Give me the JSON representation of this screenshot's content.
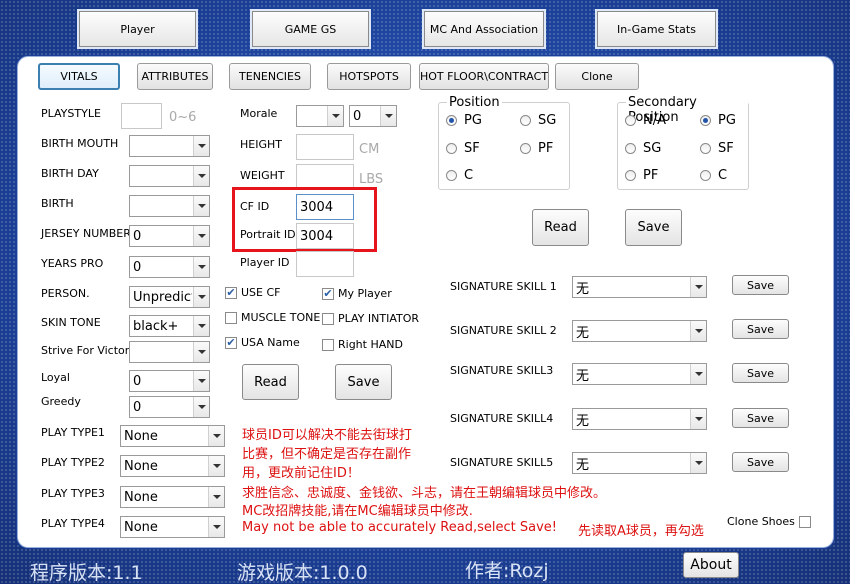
{
  "top_buttons": [
    "Player",
    "GAME GS",
    "MC And Association",
    "In-Game Stats"
  ],
  "tabs": [
    "VITALS",
    "ATTRIBUTES",
    "TENENCIES",
    "HOTSPOTS",
    "HOT FLOOR\\CONTRACT",
    "Clone"
  ],
  "left": {
    "playstyle_label": "PLAYSTYLE",
    "playstyle_hint": "0~6",
    "birth_mouth_label": "BIRTH MOUTH",
    "birth_day_label": "BIRTH DAY",
    "birth_label": "BIRTH",
    "jersey_label": "JERSEY NUMBER",
    "jersey_value": "0",
    "years_pro_label": "YEARS PRO",
    "years_pro_value": "0",
    "person_label": "PERSON.",
    "person_value": "Unpredictable",
    "skin_label": "SKIN TONE",
    "skin_value": "black+",
    "strive_label": "Strive For Victory",
    "loyal_label": "Loyal",
    "loyal_value": "0",
    "greedy_label": "Greedy",
    "greedy_value": "0",
    "play_types": [
      {
        "label": "PLAY TYPE1",
        "value": "None"
      },
      {
        "label": "PLAY TYPE2",
        "value": "None"
      },
      {
        "label": "PLAY TYPE3",
        "value": "None"
      },
      {
        "label": "PLAY TYPE4",
        "value": "None"
      }
    ]
  },
  "middle": {
    "morale_label": "Morale",
    "morale_value": "0",
    "height_label": "HEIGHT",
    "height_unit": "CM",
    "weight_label": "WEIGHT",
    "weight_unit": "LBS",
    "cfid_label": "CF ID",
    "cfid_value": "3004",
    "portrait_label": "Portrait ID",
    "portrait_value": "3004",
    "playerid_label": "Player ID",
    "checks": {
      "use_cf": "USE CF",
      "my_player": "My Player",
      "muscle": "MUSCLE TONE",
      "play_init": "PLAY INTIATOR",
      "usa": "USA Name",
      "right_hand": "Right HAND"
    },
    "read": "Read",
    "save": "Save"
  },
  "position": {
    "title": "Position",
    "options": [
      "PG",
      "SG",
      "SF",
      "PF",
      "C"
    ],
    "selected": "PG"
  },
  "secondary": {
    "title": "Secondary Position",
    "options": [
      "N/A",
      "PG",
      "SG",
      "SF",
      "PF",
      "C"
    ],
    "selected": "PG"
  },
  "pos_read": "Read",
  "pos_save": "Save",
  "skills": [
    {
      "label": "SIGNATURE SKILL 1",
      "value": "无",
      "save": "Save"
    },
    {
      "label": "SIGNATURE SKILL 2",
      "value": "无",
      "save": "Save"
    },
    {
      "label": "SIGNATURE SKILL3",
      "value": "无",
      "save": "Save"
    },
    {
      "label": "SIGNATURE SKILL4",
      "value": "无",
      "save": "Save"
    },
    {
      "label": "SIGNATURE SKILL5",
      "value": "无",
      "save": "Save"
    }
  ],
  "notes": {
    "n1": "球员ID可以解决不能去街球打",
    "n2": "比赛，但不确定是否存在副作",
    "n3": "用，更改前记住ID！",
    "n4": "求胜信念、忠诚度、金钱欲、斗志，请在王朝编辑球员中修改。",
    "n5": "MC改招牌技能,请在MC编辑球员中修改.",
    "n6": "May not be able to accurately Read,select Save!",
    "n7": "先读取A球员，再勾选"
  },
  "clone_shoes": "Clone Shoes",
  "footer": {
    "version": "程序版本:1.1",
    "game": "游戏版本:1.0.0",
    "author": "作者:Rozj",
    "about": "About"
  },
  "colors": {
    "highlight": "#e8141c",
    "note_red": "#dd1111",
    "bg_blue": "#1b3f96"
  }
}
